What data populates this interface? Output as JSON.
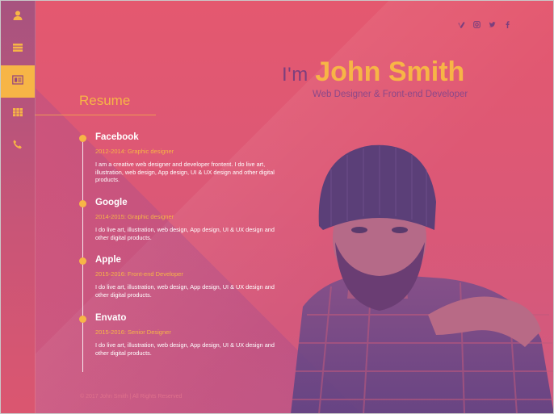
{
  "sidebar": {
    "items": [
      {
        "icon": "user-icon",
        "active": false
      },
      {
        "icon": "stack-icon",
        "active": false
      },
      {
        "icon": "resume-card-icon",
        "active": true
      },
      {
        "icon": "grid-icon",
        "active": false
      },
      {
        "icon": "phone-icon",
        "active": false
      }
    ]
  },
  "social": [
    "vimeo-icon",
    "instagram-icon",
    "twitter-icon",
    "facebook-icon"
  ],
  "hero": {
    "prefix": "I'm",
    "name": "John Smith",
    "subtitle": "Web Designer & Front-end Developer"
  },
  "resume": {
    "title": "Resume",
    "entries": [
      {
        "company": "Facebook",
        "period_role": "2012-2014: Graphic designer",
        "description": "I am a creative web designer and developer frontent. I do live art, illustration, web design, App design, UI & UX design and other digital products."
      },
      {
        "company": "Google",
        "period_role": "2014-2015: Graphic designer",
        "description": "I do live art, illustration, web design, App design, UI & UX design and other digital products."
      },
      {
        "company": "Apple",
        "period_role": "2015-2016: Front-end Developer",
        "description": "I do live art, illustration, web design, App design, UI & UX design and other digital products."
      },
      {
        "company": "Envato",
        "period_role": "2015-2016: Senior Designer",
        "description": "I do live art, illustration, web design, App design, UI & UX design and other digital products."
      }
    ]
  },
  "footer": "© 2017 John Smith | All Rights Reserved",
  "colors": {
    "accent": "#f7b546",
    "background": "#e4586f",
    "subtitle": "#8b4889"
  }
}
